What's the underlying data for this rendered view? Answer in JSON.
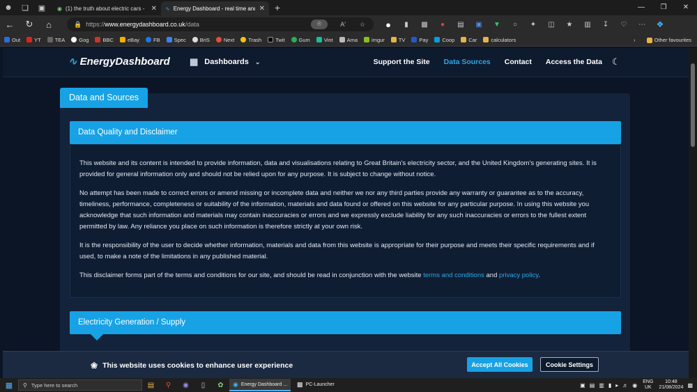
{
  "browser": {
    "tabs": [
      {
        "title": "(1) the truth about electric cars -",
        "active": false
      },
      {
        "title": "Energy Dashboard - real time and",
        "active": true
      }
    ],
    "url_prefix": "https://",
    "url_domain": "www.energydashboard.co.uk",
    "url_path": "/data",
    "bookmarks": [
      "Out",
      "YT",
      "TEA",
      "Gog",
      "BBC",
      "eBay",
      "FB",
      "Spec",
      "BriS",
      "Next",
      "Trash",
      "Twit",
      "Gum",
      "Vint",
      "Ama",
      "imgur",
      "TV",
      "Pay",
      "Coop",
      "Car",
      "calculators"
    ],
    "other_favourites": "Other favourites"
  },
  "site": {
    "logo": "EnergyDashboard",
    "dashboards": "Dashboards",
    "nav": [
      {
        "label": "Support the Site",
        "active": false
      },
      {
        "label": "Data Sources",
        "active": true
      },
      {
        "label": "Contact",
        "active": false
      },
      {
        "label": "Access the Data",
        "active": false
      }
    ],
    "card_tab": "Data and Sources",
    "section1": {
      "title": "Data Quality and Disclaimer",
      "p1": "This website and its content is intended to provide information, data and visualisations relating to Great Britain's electricity sector, and the United Kingdom's generating sites. It is provided for general information only and should not be relied upon for any purpose. It is subject to change without notice.",
      "p2": "No attempt has been made to correct errors or amend missing or incomplete data and neither we nor any third parties provide any warranty or guarantee as to the accuracy, timeliness, performance, completeness or suitability of the information, materials and data found or offered on this website for any particular purpose. In using this website you acknowledge that such information and materials may contain inaccuracies or errors and we expressly exclude liability for any such inaccuracies or errors to the fullest extent permitted by law. Any reliance you place on such information is therefore strictly at your own risk.",
      "p3": "It is the responsibility of the user to decide whether information, materials and data from this website is appropriate for their purpose and meets their specific requirements and if used, to make a note of the limitations in any published material.",
      "p4_pre": "This disclaimer forms part of the terms and conditions for our site, and should be read in conjunction with the website ",
      "p4_link1": "terms and conditions",
      "p4_mid": " and ",
      "p4_link2": "privacy policy",
      "p4_post": "."
    },
    "section2": {
      "title": "Electricity Generation / Supply"
    },
    "cookie": {
      "message": "This website uses cookies to enhance user experience",
      "accept": "Accept All Cookies",
      "settings": "Cookie Settings"
    }
  },
  "taskbar": {
    "search_placeholder": "Type here to search",
    "windows": [
      {
        "label": "Energy Dashboard ...",
        "active": true
      },
      {
        "label": "PC-Launcher",
        "active": false
      }
    ],
    "lang1": "ENG",
    "lang2": "UK",
    "time": "10:48",
    "date": "21/08/2024"
  },
  "colors": {
    "accent": "#17a2e6",
    "page_bg": "#0b1526",
    "card_bg": "#13233b"
  }
}
